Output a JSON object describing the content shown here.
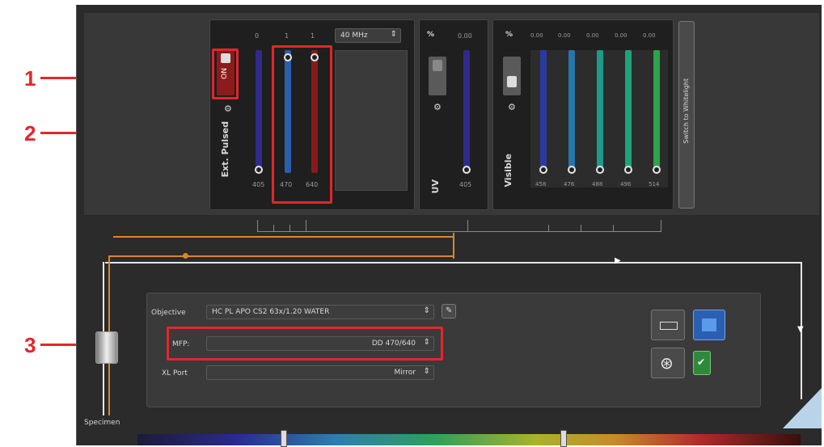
{
  "callouts": [
    "1",
    "2",
    "3"
  ],
  "ext_pulsed": {
    "label": "Ext. Pulsed",
    "on_label": "ON",
    "top_values": [
      "0",
      "1",
      "1"
    ],
    "frequency": "40 MHz",
    "wavelengths": [
      "405",
      "470",
      "640"
    ]
  },
  "uv": {
    "percent_label": "%",
    "value": "0.00",
    "label": "UV",
    "wavelength": "405"
  },
  "visible": {
    "percent_label": "%",
    "values": [
      "0.00",
      "0.00",
      "0.00",
      "0.00",
      "0.00"
    ],
    "label": "Visible",
    "wavelengths": [
      "458",
      "476",
      "488",
      "496",
      "514"
    ]
  },
  "switch_button": "Switch to Whitelight",
  "beam_path": {
    "objective_label": "Objective",
    "objective_value": "HC PL APO CS2 63x/1.20 WATER",
    "mfp_label": "MFP:",
    "mfp_value": "DD 470/640",
    "xl_port_label": "XL Port",
    "xl_port_value": "Mirror",
    "specimen_label": "Specimen"
  },
  "colors": {
    "callout_red": "#e3262b",
    "slider_405": "#2f2a8c",
    "slider_470": "#2a5fae",
    "slider_640": "#8a1a1a",
    "beam_orange": "#d9882a"
  }
}
